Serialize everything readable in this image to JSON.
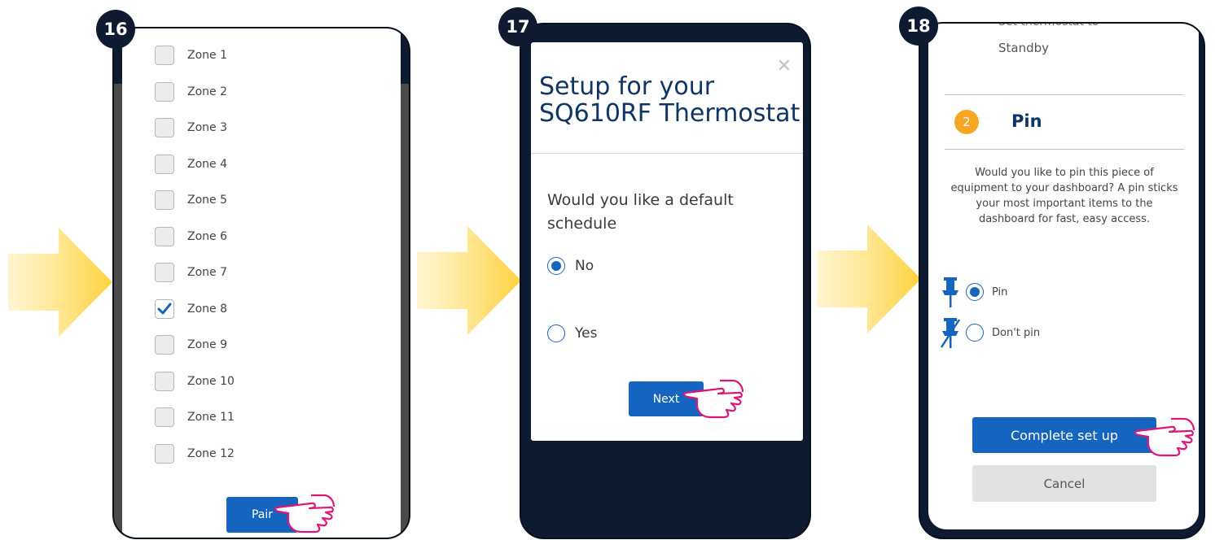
{
  "steps": [
    {
      "number": "16"
    },
    {
      "number": "17"
    },
    {
      "number": "18"
    }
  ],
  "colors": {
    "arrow": "#ffd84a",
    "dark_navy": "#0d1a2f",
    "button_blue": "#1565c0",
    "hand_outline": "#e0157a",
    "step_badge_orange": "#f5a623"
  },
  "screen16": {
    "zones": [
      {
        "label": "Zone 1",
        "checked": false
      },
      {
        "label": "Zone 2",
        "checked": false
      },
      {
        "label": "Zone 3",
        "checked": false
      },
      {
        "label": "Zone 4",
        "checked": false
      },
      {
        "label": "Zone 5",
        "checked": false
      },
      {
        "label": "Zone 6",
        "checked": false
      },
      {
        "label": "Zone 7",
        "checked": false
      },
      {
        "label": "Zone 8",
        "checked": true
      },
      {
        "label": "Zone 9",
        "checked": false
      },
      {
        "label": "Zone 10",
        "checked": false
      },
      {
        "label": "Zone 11",
        "checked": false
      },
      {
        "label": "Zone 12",
        "checked": false
      }
    ],
    "pair_button": "Pair"
  },
  "screen17": {
    "title": "Setup for your SQ610RF Thermostat",
    "question": "Would you like a default schedule",
    "options": [
      {
        "label": "No",
        "selected": true
      },
      {
        "label": "Yes",
        "selected": false
      }
    ],
    "next_button": "Next",
    "close_icon": "close-icon"
  },
  "screen18": {
    "previous_text": "Set thermostat to",
    "standby": "Standby",
    "step_number": "2",
    "heading": "Pin",
    "description": "Would you like to pin this piece of equipment to your dashboard? A pin sticks your most important items to the dashboard for fast, easy access.",
    "options": [
      {
        "label": "Pin",
        "selected": true,
        "icon": "pin-icon"
      },
      {
        "label": "Don't pin",
        "selected": false,
        "icon": "unpin-icon"
      }
    ],
    "complete_button": "Complete set up",
    "cancel_button": "Cancel"
  }
}
